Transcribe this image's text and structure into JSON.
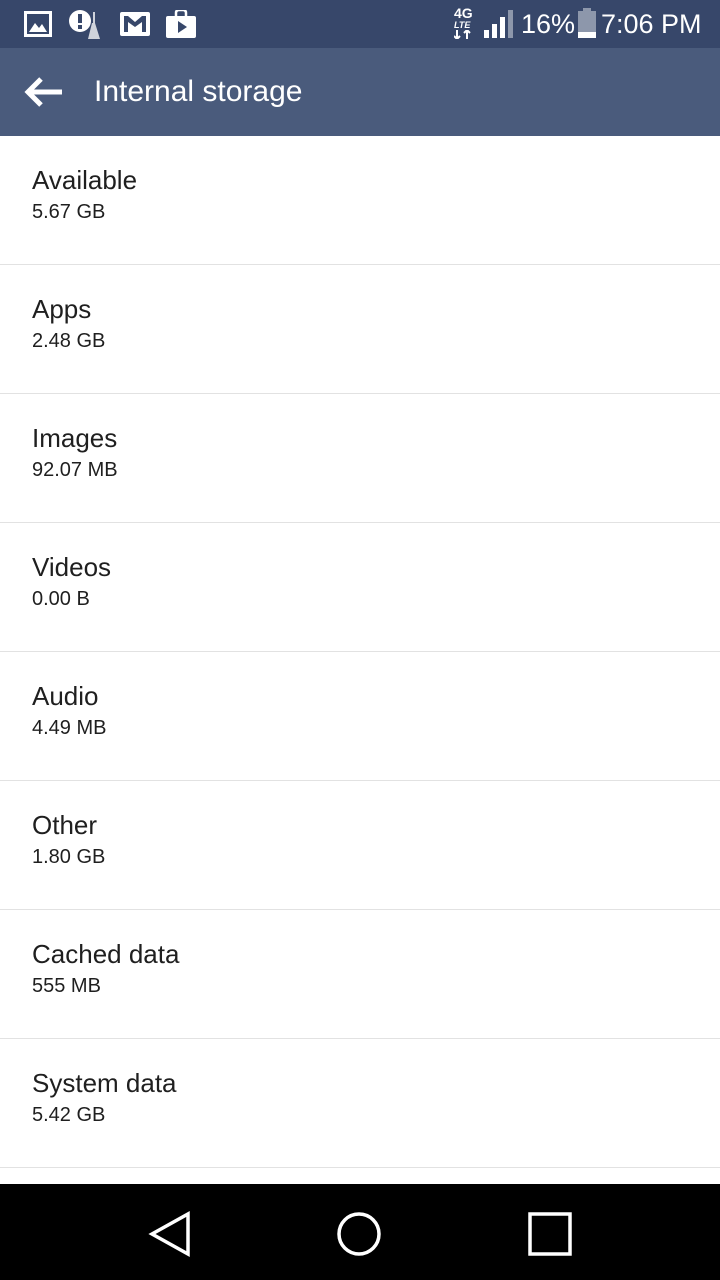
{
  "status_bar": {
    "left_icons": [
      "gallery-icon",
      "alert-cleaner-icon",
      "gmail-icon",
      "play-store-icon"
    ],
    "network_label": "4G",
    "network_sub": "LTE",
    "battery_percent": "16%",
    "time": "7:06 PM"
  },
  "app_bar": {
    "title": "Internal storage",
    "back_icon": "arrow-back-icon"
  },
  "storage_items": [
    {
      "label": "Available",
      "value": "5.67 GB"
    },
    {
      "label": "Apps",
      "value": "2.48 GB"
    },
    {
      "label": "Images",
      "value": "92.07 MB"
    },
    {
      "label": "Videos",
      "value": "0.00 B"
    },
    {
      "label": "Audio",
      "value": "4.49 MB"
    },
    {
      "label": "Other",
      "value": "1.80 GB"
    },
    {
      "label": "Cached data",
      "value": "555 MB"
    },
    {
      "label": "System data",
      "value": "5.42 GB"
    }
  ],
  "nav_bar": {
    "back": "nav-back-icon",
    "home": "nav-home-icon",
    "recents": "nav-recents-icon"
  },
  "colors": {
    "status_bar": "#37476a",
    "app_bar": "#4a5b7c",
    "divider": "#e2e2e2",
    "text": "#1f1f1f"
  }
}
